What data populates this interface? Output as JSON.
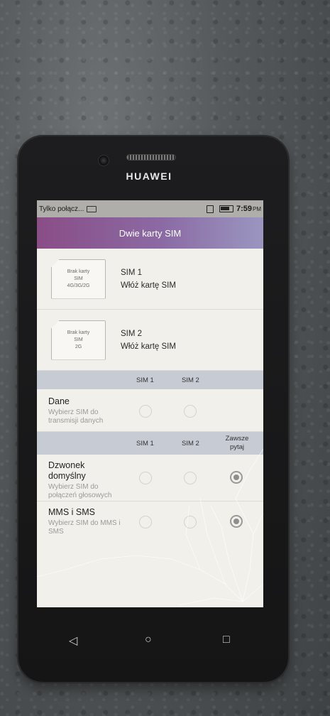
{
  "device": {
    "brand": "HUAWEI"
  },
  "status_bar": {
    "carrier": "Tylko połącz...",
    "time": "7:59",
    "ampm": "PM"
  },
  "header": {
    "title": "Dwie karty SIM"
  },
  "sims": [
    {
      "card_text": [
        "Brak karty",
        "SIM",
        "4G/3G/2G"
      ],
      "name": "SIM 1",
      "status": "Włóż kartę SIM"
    },
    {
      "card_text": [
        "Brak karty",
        "SIM",
        "2G"
      ],
      "name": "SIM 2",
      "status": "Włóż kartę SIM"
    }
  ],
  "data_section": {
    "columns": [
      "SIM 1",
      "SIM 2"
    ],
    "title": "Dane",
    "subtitle_lines": [
      "Wybierz SIM do",
      "transmisji danych"
    ]
  },
  "call_section": {
    "columns": [
      "SIM 1",
      "SIM 2",
      "Zawsze",
      "pytaj"
    ],
    "rows": [
      {
        "title_lines": [
          "Dzwonek",
          "domyślny"
        ],
        "subtitle_lines": [
          "Wybierz SIM do",
          "połączeń głosowych"
        ],
        "selected": "Zawsze pytaj"
      },
      {
        "title_lines": [
          "MMS i SMS"
        ],
        "subtitle_lines": [
          "Wybierz SIM do MMS i",
          "SMS"
        ],
        "selected": "Zawsze pytaj"
      }
    ]
  },
  "navbar": {
    "back_icon": "back-triangle-icon",
    "home_icon": "home-circle-icon",
    "recents_icon": "recents-square-icon"
  }
}
